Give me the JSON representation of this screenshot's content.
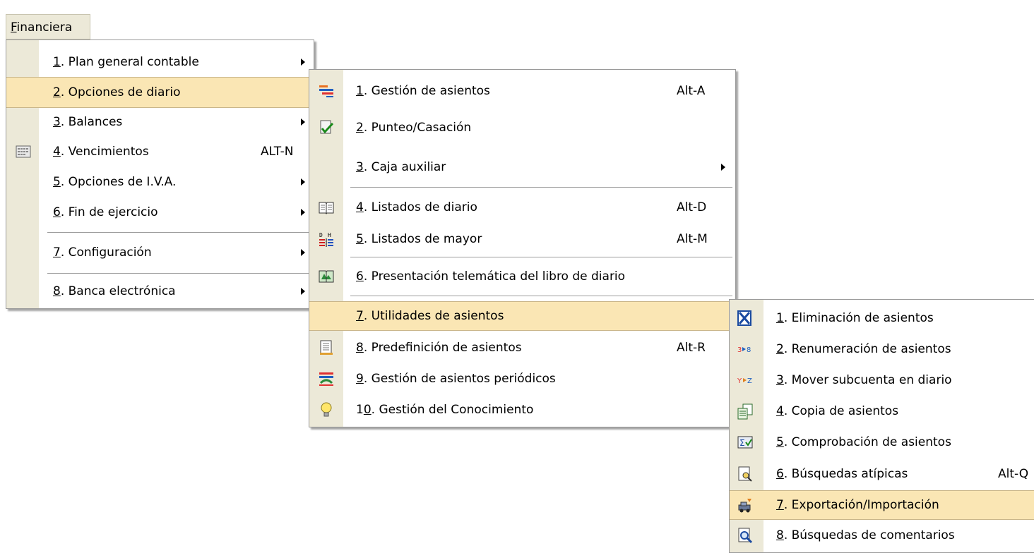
{
  "menubar": {
    "title_prefix": "F",
    "title_rest": "inanciera"
  },
  "menu1": {
    "items": [
      {
        "num": "1",
        "label": ". Plan general contable",
        "shortcut": "",
        "submenu": true
      },
      {
        "num": "2",
        "label": ". Opciones de diario",
        "shortcut": "",
        "submenu": true
      },
      {
        "num": "3",
        "label": ". Balances",
        "shortcut": "",
        "submenu": true
      },
      {
        "num": "4",
        "label": ". Vencimientos",
        "shortcut": "ALT-N",
        "submenu": false
      },
      {
        "num": "5",
        "label": ". Opciones de I.V.A.",
        "shortcut": "",
        "submenu": true
      },
      {
        "num": "6",
        "label": ". Fin de ejercicio",
        "shortcut": "",
        "submenu": true
      },
      {
        "num": "7",
        "label": ". Configuración",
        "shortcut": "",
        "submenu": true
      },
      {
        "num": "8",
        "label": ". Banca electrónica",
        "shortcut": "",
        "submenu": true
      }
    ]
  },
  "menu2": {
    "items": [
      {
        "num": "1",
        "label": ". Gestión de asientos",
        "shortcut": "Alt-A"
      },
      {
        "num": "2",
        "label": ". Punteo/Casación",
        "shortcut": ""
      },
      {
        "num": "3",
        "label": ". Caja auxiliar",
        "shortcut": ""
      },
      {
        "num": "4",
        "label": ". Listados de diario",
        "shortcut": "Alt-D"
      },
      {
        "num": "5",
        "label": ". Listados de mayor",
        "shortcut": "Alt-M"
      },
      {
        "num": "6",
        "label": ". Presentación telemática del libro de diario",
        "shortcut": ""
      },
      {
        "num": "7",
        "label": ". Utilidades de asientos",
        "shortcut": ""
      },
      {
        "num": "8",
        "label": ". Predefinición de asientos",
        "shortcut": "Alt-R"
      },
      {
        "num": "9",
        "label": ". Gestión de asientos periódicos",
        "shortcut": ""
      },
      {
        "num_pre": "1",
        "num": "0",
        "label": ". Gestión del Conocimiento",
        "shortcut": ""
      }
    ]
  },
  "menu3": {
    "items": [
      {
        "num": "1",
        "label": ". Eliminación de asientos",
        "shortcut": ""
      },
      {
        "num": "2",
        "label": ". Renumeración de asientos",
        "shortcut": ""
      },
      {
        "num": "3",
        "label": ". Mover subcuenta en diario",
        "shortcut": ""
      },
      {
        "num": "4",
        "label": ". Copia de asientos",
        "shortcut": ""
      },
      {
        "num": "5",
        "label": ". Comprobación de asientos",
        "shortcut": ""
      },
      {
        "num": "6",
        "label": ". Búsquedas atípicas",
        "shortcut": "Alt-Q"
      },
      {
        "num": "7",
        "label": ". Exportación/Importación",
        "shortcut": ""
      },
      {
        "num": "8",
        "label": ". Búsquedas de comentarios",
        "shortcut": ""
      }
    ]
  },
  "icons": {
    "vencimientos": "calendar-icon",
    "gestion_asientos": "journal-lines-icon",
    "punteo": "checked-document-icon",
    "listados_diario": "open-book-icon",
    "listados_mayor": "ledger-dh-icon",
    "presentacion": "green-book-icon",
    "predefinicion": "template-document-icon",
    "periodicos": "periodic-entries-icon",
    "conocimiento": "lightbulb-icon",
    "eliminacion": "delete-x-icon",
    "renumeracion": "renumber-icon",
    "mover": "move-yz-icon",
    "copia": "copy-documents-icon",
    "comprobacion": "sigma-check-icon",
    "busquedas_atipicas": "search-document-icon",
    "exportacion": "export-import-icon",
    "busquedas_comentarios": "magnifier-document-icon"
  },
  "colors": {
    "highlight": "#fae6b4",
    "strip": "#ece9d8"
  }
}
